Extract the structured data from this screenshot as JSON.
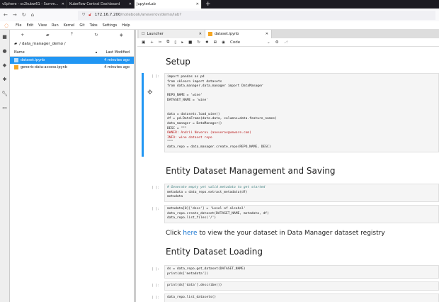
{
  "browser": {
    "tabs": [
      {
        "label": "vSphere - sc2kubw61 - Summ..."
      },
      {
        "label": "Kubeflow Central Dashboard"
      },
      {
        "label": "JupyterLab"
      }
    ],
    "url_host": "172.16.7.200",
    "url_path": "/notebook/aneverov/demo/lab?"
  },
  "menu": [
    "File",
    "Edit",
    "View",
    "Run",
    "Kernel",
    "Git",
    "Tabs",
    "Settings",
    "Help"
  ],
  "filebrowser": {
    "breadcrumb": "/ data_manager_demo /",
    "col_name": "Name",
    "col_modified": "Last Modified",
    "files": [
      {
        "name": "dataset.ipynb",
        "modified": "4 minutes ago",
        "selected": true
      },
      {
        "name": "generic-data-access.ipynb",
        "modified": "4 minutes ago",
        "selected": false
      }
    ]
  },
  "doc_tabs": [
    {
      "label": "Launcher"
    },
    {
      "label": "dataset.ipynb"
    }
  ],
  "toolbar": {
    "cell_type": "Code"
  },
  "notebook": {
    "h_setup": "Setup",
    "prompt": "[ ]:",
    "cell1": [
      "import pandas as pd",
      "from sklearn import datasets",
      "from data_manager.data_manager import DataManager",
      "",
      "REPO_NAME = 'wine'",
      "DATASET_NAME = 'wine'",
      "",
      "",
      "data = datasets.load_wine()",
      "df = pd.DataFrame(data.data, columns=data.feature_names)",
      "data_manager = DataManager()",
      "DESC = \"\"\"",
      "OWNER: Andrii Neverov (aneverov@vmware.com)",
      "INFO: wine dataset repo",
      "\"\"\"",
      "data_repo = data_manager.create_repo(REPO_NAME, DESC)"
    ],
    "h_mgmt": "Entity Dataset Management and Saving",
    "cell2": [
      "# Generate empty yet valid metadata to get started",
      "metadata = data_repo.extract_metadata(df)",
      "metadata"
    ],
    "cell3": [
      "metadata[0]['desc'] = 'Level of alcohol'",
      "data_repo.create_dataset(DATASET_NAME, metadata, df)",
      "data_repo.list_files('/')"
    ],
    "md_click": "Click ",
    "md_link": "here",
    "md_rest": " to view the your dataset in Data Manager dataset registry",
    "h_load": "Entity Dataset Loading",
    "cell4": [
      "ds = data_repo.get_dataset(DATASET_NAME)",
      "print(ds['metadata'])"
    ],
    "cell5": [
      "print(ds['data'].describe())"
    ],
    "cell6": [
      "data_repo.list_datasets()"
    ]
  },
  "colors": {
    "accent": "#2196f3",
    "jupyter": "#f37726"
  }
}
